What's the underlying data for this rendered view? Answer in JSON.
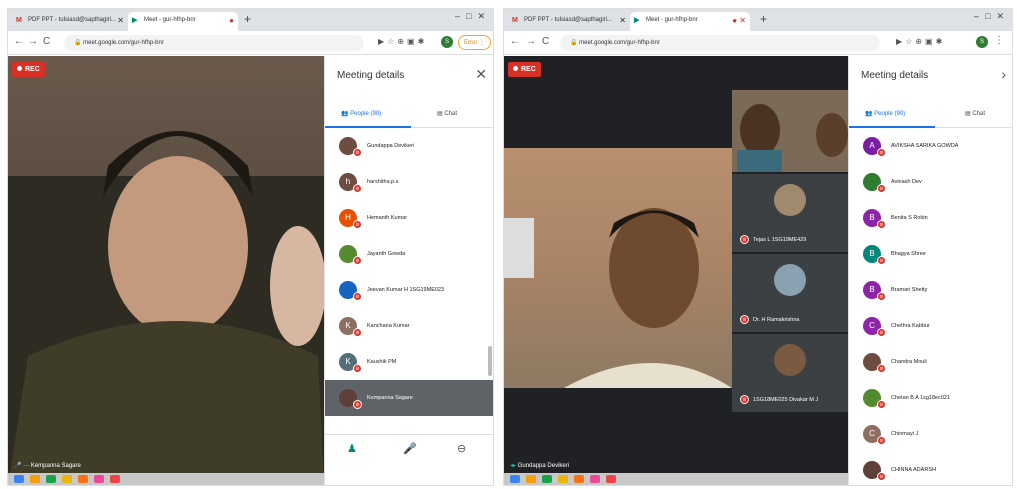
{
  "left": {
    "tabs": [
      {
        "label": "PDF PPT - tulsiasd@sapthagiri...",
        "icon": "gmail-icon",
        "color": "#d93025"
      },
      {
        "label": "Meet - gur-hfhp-bnr",
        "icon": "meet-icon",
        "color": "#00897b"
      }
    ],
    "url": "meet.google.com/gur-hfhp-bnr",
    "error_label": "Error",
    "rec_label": "REC",
    "speaker_name": "Kempanna Sagare",
    "panel": {
      "title": "Meeting details",
      "people_tab": "People (90)",
      "chat_tab": "Chat",
      "people": [
        {
          "name": "Gundappa Devikeri",
          "initial": "",
          "color": "#6d4c41"
        },
        {
          "name": "harshitha.p.s",
          "initial": "h",
          "color": "#6d4c41"
        },
        {
          "name": "Hemanth Kumar",
          "initial": "H",
          "color": "#e65100"
        },
        {
          "name": "Jayanth Gowda",
          "initial": "",
          "color": "#558b2f"
        },
        {
          "name": "Jeevan Kumar H 1SG19ME023",
          "initial": "",
          "color": "#1565c0"
        },
        {
          "name": "Kanchana Kumar",
          "initial": "K",
          "color": "#8d6e63"
        },
        {
          "name": "Kaushik PM",
          "initial": "K",
          "color": "#546e7a"
        },
        {
          "name": "Kempanna Sagare",
          "initial": "",
          "color": "#5d4037"
        }
      ]
    }
  },
  "right": {
    "tabs": [
      {
        "label": "PDF PPT - tulsiasd@sapthagiri...",
        "icon": "gmail-icon",
        "color": "#d93025"
      },
      {
        "label": "Meet - gur-hfhp-bnr",
        "icon": "meet-icon",
        "color": "#00897b"
      }
    ],
    "url": "meet.google.com/gur-hfhp-bnr",
    "rec_label": "REC",
    "speaker_name": "Gundappa Devikeri",
    "tiles": [
      {
        "name": "Tejas L 1SG19ME429"
      },
      {
        "name": "Dr. H Ramakrishna"
      },
      {
        "name": "1SG18ME025 Divakar M J"
      }
    ],
    "panel": {
      "title": "Meeting details",
      "people_tab": "People (90)",
      "chat_tab": "Chat",
      "people": [
        {
          "name": "AVIKSHA SARIKA GOWDA",
          "initial": "A",
          "color": "#7b1fa2"
        },
        {
          "name": "Avinash Dev",
          "initial": "",
          "color": "#2e7d32"
        },
        {
          "name": "Benita S Robin",
          "initial": "B",
          "color": "#8e24aa"
        },
        {
          "name": "Bhagya Shree",
          "initial": "B",
          "color": "#00897b"
        },
        {
          "name": "Bramari Shetty",
          "initial": "B",
          "color": "#8e24aa"
        },
        {
          "name": "Chethra Kabbur",
          "initial": "C",
          "color": "#8e24aa"
        },
        {
          "name": "Chandra Mouli",
          "initial": "",
          "color": "#6d4c41"
        },
        {
          "name": "Chetan B A 1sg18ec021",
          "initial": "",
          "color": "#558b2f"
        },
        {
          "name": "Chinmayi J",
          "initial": "C",
          "color": "#8d6e63"
        },
        {
          "name": "CHINNA ADARSH",
          "initial": "",
          "color": "#5d4037"
        }
      ]
    }
  }
}
